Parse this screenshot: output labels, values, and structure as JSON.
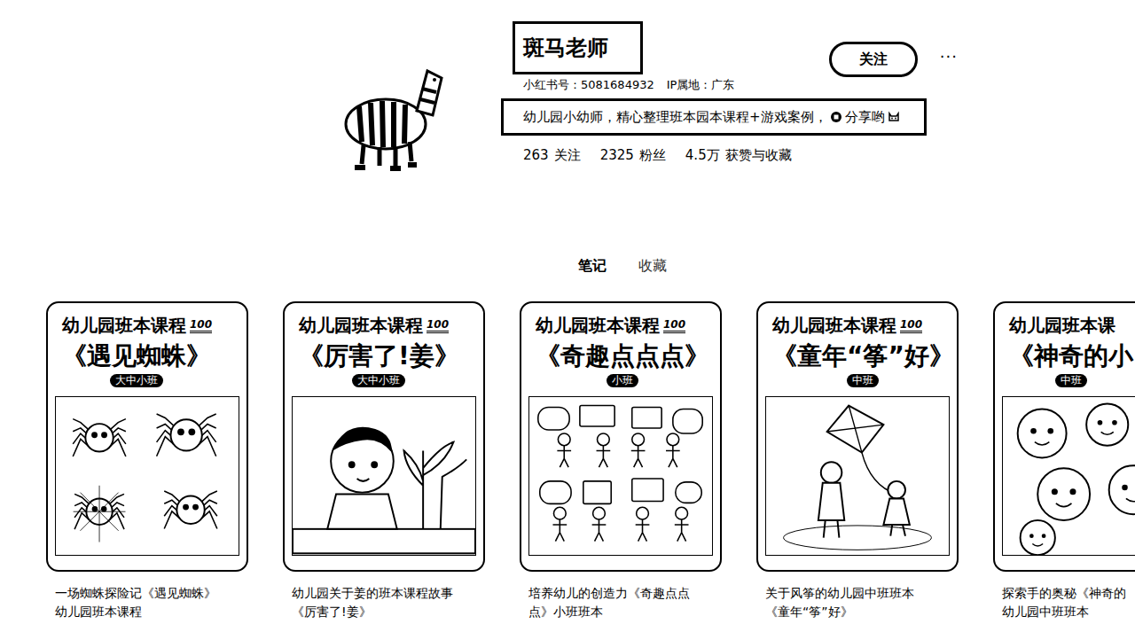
{
  "profile": {
    "name": "斑马老师",
    "id_label": "小红书号：5081684932",
    "ip_label": "IP属地：广东",
    "bio": "幼儿园小幼师，精心整理班本园本课程+游戏案例，",
    "bio_tail": "分享哟",
    "follow_button": "关注",
    "more": "···"
  },
  "stats": [
    {
      "value": "263",
      "label": "关注"
    },
    {
      "value": "2325",
      "label": "粉丝"
    },
    {
      "value": "4.5万",
      "label": "获赞与收藏"
    }
  ],
  "tabs": [
    {
      "label": "笔记",
      "selected": true
    },
    {
      "label": "收藏",
      "selected": false
    }
  ],
  "notes": [
    {
      "header": "幼儿园班本课程",
      "mark": "100",
      "title": "《遇见蜘蛛》",
      "grade": "大中小班",
      "kind": "spiders",
      "caption": [
        "一场蜘蛛探险记《遇见蜘蛛》",
        "幼儿园班本课程"
      ]
    },
    {
      "header": "幼儿园班本课程",
      "mark": "100",
      "title": "《厉害了!姜》",
      "grade": "大中小班",
      "kind": "boy",
      "caption": [
        "幼儿园关于姜的班本课程故事",
        "《厉害了!姜》"
      ]
    },
    {
      "header": "幼儿园班本课程",
      "mark": "100",
      "title": "《奇趣点点点》",
      "grade": "小班",
      "kind": "bubbles",
      "caption": [
        "培养幼儿的创造力《奇趣点点",
        "点》小班班本"
      ]
    },
    {
      "header": "幼儿园班本课程",
      "mark": "100",
      "title": "《童年“筝”好》",
      "grade": "中班",
      "kind": "kite",
      "caption": [
        "关于风筝的幼儿园中班班本",
        "《童年“筝”好》"
      ]
    },
    {
      "header": "幼儿园班本课",
      "title": "《神奇的小",
      "grade": "中班",
      "kind": "faces",
      "caption": [
        "探索手的奥秘《神奇的",
        "幼儿园中班班本"
      ]
    }
  ]
}
